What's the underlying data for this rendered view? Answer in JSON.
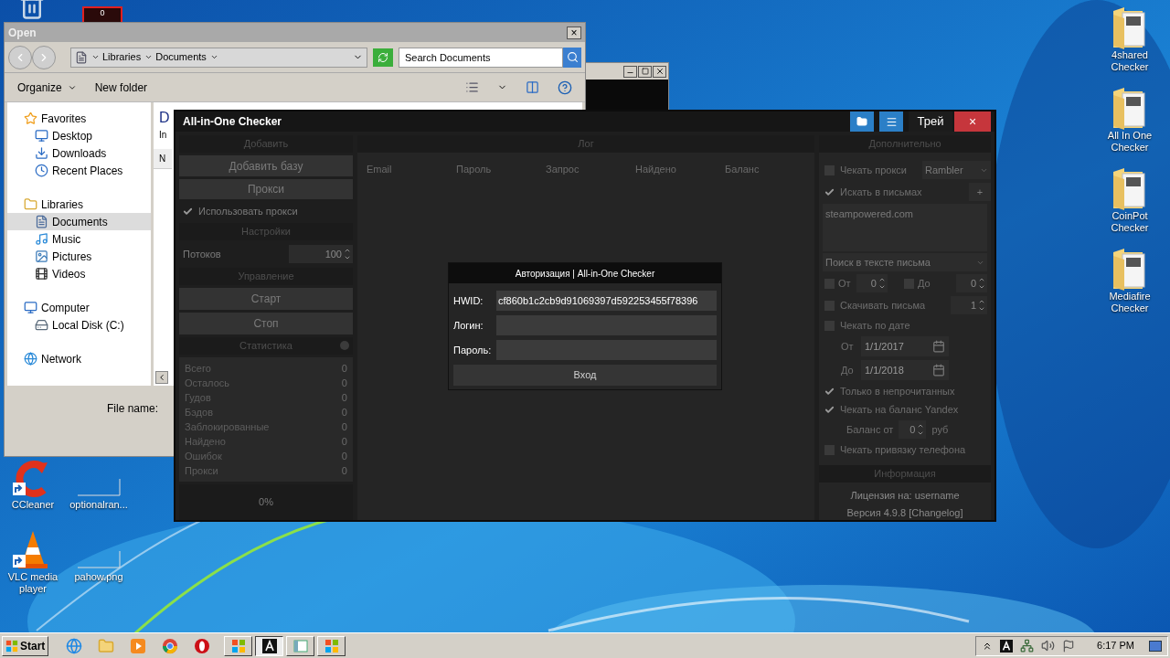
{
  "desktop_icons_left": [
    {
      "label": "CCleaner",
      "shortcut": true
    },
    {
      "label": "optionalran...",
      "shortcut": false
    },
    {
      "label": "VLC media player",
      "shortcut": true
    },
    {
      "label": "pahow.png",
      "shortcut": false
    }
  ],
  "desktop_icons_right": [
    {
      "label": "4shared Checker"
    },
    {
      "label": "All In One Checker"
    },
    {
      "label": "CoinPot Checker"
    },
    {
      "label": "Mediafire Checker"
    }
  ],
  "top_icon_badge": "0",
  "open_dialog": {
    "title": "Open",
    "close": "×",
    "path": [
      "Libraries",
      "Documents"
    ],
    "search": {
      "placeholder": "Search Documents"
    },
    "toolbar": [
      "Organize",
      "New folder"
    ],
    "nav": [
      {
        "label": "Favorites",
        "selected": false,
        "children": [
          {
            "label": "Desktop",
            "selected": false
          },
          {
            "label": "Downloads",
            "selected": false
          },
          {
            "label": "Recent Places",
            "selected": false
          }
        ]
      },
      {
        "label": "Libraries",
        "selected": false,
        "children": [
          {
            "label": "Documents",
            "selected": true
          },
          {
            "label": "Music",
            "selected": false
          },
          {
            "label": "Pictures",
            "selected": false
          },
          {
            "label": "Videos",
            "selected": false
          }
        ]
      },
      {
        "label": "Computer",
        "selected": false,
        "children": [
          {
            "label": "Local Disk (C:)",
            "selected": false
          }
        ]
      },
      {
        "label": "Network",
        "selected": false
      }
    ],
    "content_heading": "D",
    "content_subtitle": "In",
    "column_1": "N",
    "file_name_label": "File name:"
  },
  "checker": {
    "title": "All-in-One Checker",
    "tray_button": "Трей",
    "close": "×",
    "left": {
      "add_header": "Добавить",
      "add_buttons": [
        "Добавить базу",
        "Прокси"
      ],
      "use_proxy": {
        "label": "Использовать прокси",
        "checked": true
      },
      "settings_header": "Настройки",
      "threads": {
        "label": "Потоков",
        "value": "100"
      },
      "control_header": "Управление",
      "control_buttons": [
        "Старт",
        "Стоп"
      ],
      "stats_header": "Статистика",
      "stats": [
        {
          "label": "Всего",
          "value": "0"
        },
        {
          "label": "Осталось",
          "value": "0"
        },
        {
          "label": "Гудов",
          "value": "0"
        },
        {
          "label": "Бэдов",
          "value": "0"
        },
        {
          "label": "Заблокированные",
          "value": "0"
        },
        {
          "label": "Найдено",
          "value": "0"
        },
        {
          "label": "Ошибок",
          "value": "0"
        },
        {
          "label": "Прокси",
          "value": "0"
        }
      ],
      "progress": "0%"
    },
    "log": {
      "header": "Лог",
      "columns": [
        "Email",
        "Пароль",
        "Запрос",
        "Найдено",
        "Баланс"
      ]
    },
    "extra": {
      "header": "Дополнительно",
      "rows": [
        {
          "kind": "check_select",
          "label": "Чекать прокси",
          "checked": false,
          "value": "Rambler"
        },
        {
          "kind": "check_button",
          "label": "Искать в письмах",
          "checked": true,
          "button": "+"
        },
        {
          "kind": "textarea",
          "value": "steampowered.com"
        },
        {
          "kind": "select",
          "value": "Поиск в тексте письма"
        },
        {
          "kind": "range",
          "from": {
            "label": "От",
            "checked": false,
            "value": "0"
          },
          "to": {
            "label": "До",
            "checked": false,
            "value": "0"
          }
        },
        {
          "kind": "check_spin",
          "label": "Скачивать письма",
          "checked": false,
          "value": "1"
        },
        {
          "kind": "check",
          "label": "Чекать по дате",
          "checked": false
        },
        {
          "kind": "date",
          "label": "От",
          "value": "1/1/2017"
        },
        {
          "kind": "date",
          "label": "До",
          "value": "1/1/2018"
        },
        {
          "kind": "check",
          "label": "Только в непрочитанных",
          "checked": true
        },
        {
          "kind": "check",
          "label": "Чекать на баланс Yandex",
          "checked": true
        },
        {
          "kind": "balance",
          "label": "Баланс от",
          "value": "0",
          "unit": "руб"
        },
        {
          "kind": "check",
          "label": "Чекать привязку телефона",
          "checked": false
        }
      ],
      "info_header": "Информация",
      "license": "Лицензия на: username",
      "version": "Версия 4.9.8 [Changelog]"
    }
  },
  "auth": {
    "title": "Авторизация | All-in-One Checker",
    "fields": [
      {
        "label": "HWID:",
        "value": "cf860b1c2cb9d91069397d592253455f78396"
      },
      {
        "label": "Логин:"
      },
      {
        "label": "Пароль:"
      }
    ],
    "button": "Вход"
  },
  "taskbar": {
    "start": "Start",
    "tasks": [
      {
        "selected": false
      },
      {
        "selected": true
      },
      {
        "selected": false
      },
      {
        "selected": false
      }
    ],
    "clock": "6:17 PM"
  }
}
